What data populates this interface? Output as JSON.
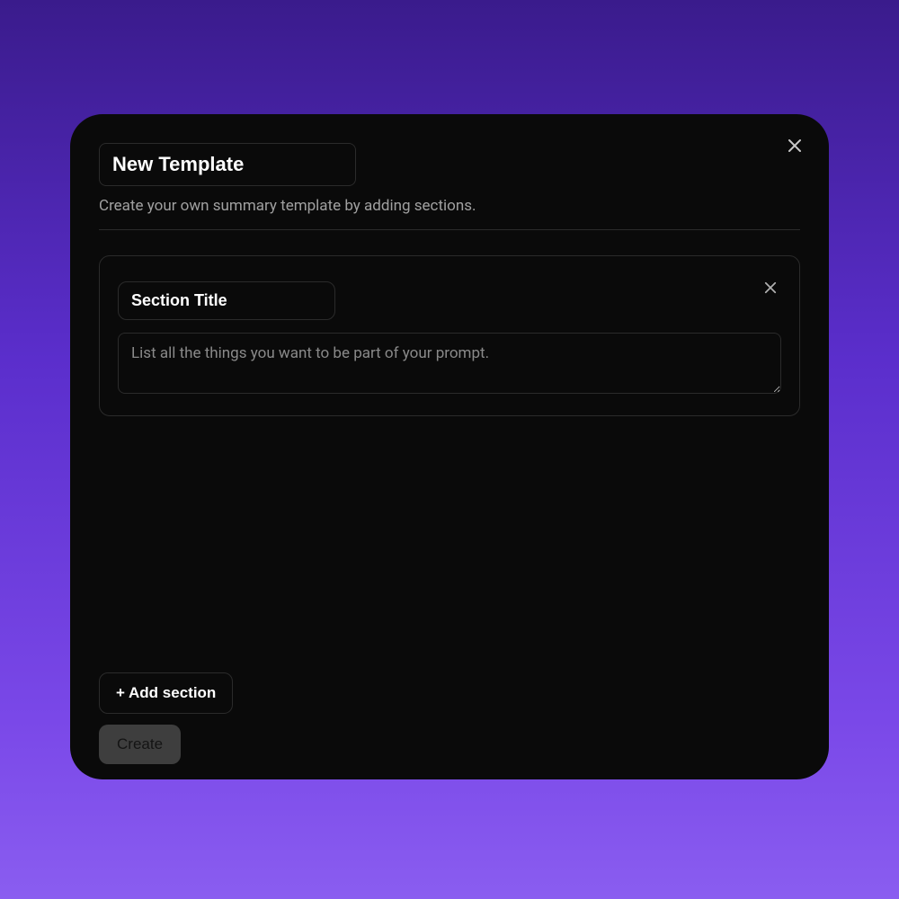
{
  "modal": {
    "title_placeholder": "New Template",
    "subtitle": "Create your own summary template by adding sections."
  },
  "section": {
    "title_placeholder": "Section Title",
    "body_placeholder": "List all the things you want to be part of your prompt."
  },
  "buttons": {
    "add_section": "+ Add section",
    "create": "Create"
  }
}
